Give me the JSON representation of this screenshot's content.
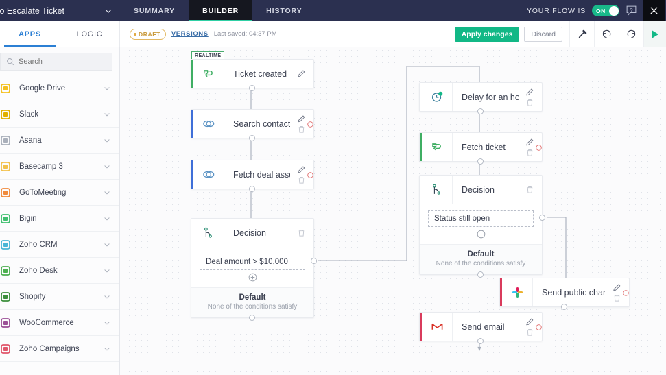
{
  "topnav": {
    "flow_title": "to Escalate Ticket",
    "tabs": [
      {
        "label": "SUMMARY",
        "active": false
      },
      {
        "label": "BUILDER",
        "active": true
      },
      {
        "label": "HISTORY",
        "active": false
      }
    ],
    "flow_state_label": "YOUR FLOW IS",
    "toggle_value": "ON",
    "help_glyph": "?",
    "close_glyph": "✕"
  },
  "subbar": {
    "tabs": [
      {
        "label": "APPS",
        "active": true
      },
      {
        "label": "LOGIC",
        "active": false
      }
    ],
    "status_badge": "DRAFT",
    "versions_label": "VERSIONS",
    "last_saved": "Last saved: 04:37 PM",
    "apply_label": "Apply changes",
    "discard_label": "Discard"
  },
  "sidebar": {
    "search_placeholder": "Search",
    "search_value": "",
    "apps": [
      {
        "name": "Google Drive",
        "color": "#f4c020"
      },
      {
        "name": "Slack",
        "color": "#e0b000"
      },
      {
        "name": "Asana",
        "color": "#aab0bb"
      },
      {
        "name": "Basecamp 3",
        "color": "#f2c14b"
      },
      {
        "name": "GoToMeeting",
        "color": "#f08a3c"
      },
      {
        "name": "Bigin",
        "color": "#3fbf6f"
      },
      {
        "name": "Zoho CRM",
        "color": "#49b6d6"
      },
      {
        "name": "Zoho Desk",
        "color": "#4caf50"
      },
      {
        "name": "Shopify",
        "color": "#3c8f3c"
      },
      {
        "name": "WooCommerce",
        "color": "#9b4f96"
      },
      {
        "name": "Zoho Campaigns",
        "color": "#e0566b"
      }
    ]
  },
  "canvas": {
    "nodes": [
      {
        "id": "ticket-created",
        "label": "Ticket created",
        "badge": "REALTIME",
        "accent": "#3fae63",
        "icon": "zoho-desk-icon",
        "has_edit": true,
        "has_delete": false,
        "has_error": false
      },
      {
        "id": "search-contact-in-crm",
        "label": "Search contact in CRM",
        "accent": "#3f6fd8",
        "icon": "link-rings-icon",
        "has_edit": true,
        "has_delete": true,
        "has_error": true
      },
      {
        "id": "fetch-deal-associated",
        "label": "Fetch deal associated ...",
        "accent": "#3f6fd8",
        "icon": "link-rings-icon",
        "has_edit": true,
        "has_delete": true,
        "has_error": true
      },
      {
        "id": "decision-left",
        "label": "Decision",
        "icon": "decision-branch-icon",
        "has_edit": false,
        "has_delete": true,
        "has_error": false,
        "condition": "Deal amount > $10,000",
        "default_title": "Default",
        "default_sub": "None of the conditions satisfy"
      },
      {
        "id": "delay-for-an-hour",
        "label": "Delay for an hour",
        "icon": "clock-icon",
        "has_edit": true,
        "has_delete": true,
        "has_error": false
      },
      {
        "id": "fetch-ticket",
        "label": "Fetch ticket",
        "accent": "#3fae63",
        "icon": "zoho-desk-icon",
        "has_edit": true,
        "has_delete": true,
        "has_error": true
      },
      {
        "id": "decision-mid",
        "label": "Decision",
        "icon": "decision-branch-icon",
        "has_edit": false,
        "has_delete": true,
        "has_error": false,
        "condition": "Status still open",
        "default_title": "Default",
        "default_sub": "None of the conditions satisfy"
      },
      {
        "id": "send-public-channel-message",
        "label": "Send public channel m...",
        "accent": "#d93b5c",
        "icon": "slack-icon",
        "has_edit": true,
        "has_delete": true,
        "has_error": true
      },
      {
        "id": "send-email",
        "label": "Send email",
        "accent": "#d93b5c",
        "icon": "gmail-icon",
        "has_edit": true,
        "has_delete": true,
        "has_error": true
      }
    ]
  },
  "colors": {
    "nav_bg": "#2b3050",
    "accent_green": "#12b886",
    "accent_blue": "#2b7fd4",
    "draft_amber": "#c99a3c",
    "error_red": "#e06b6b"
  }
}
